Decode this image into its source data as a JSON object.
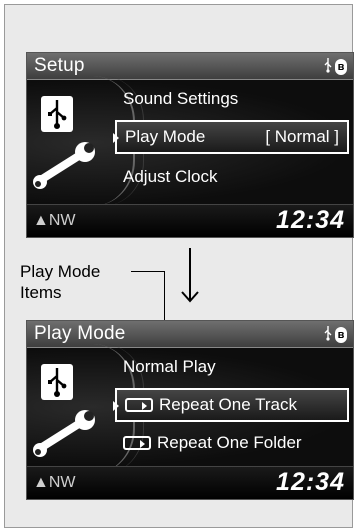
{
  "screens": [
    {
      "title": "Setup",
      "items": [
        {
          "label": "Sound Settings",
          "value": ""
        },
        {
          "label": "Play Mode",
          "value": "[ Normal ]"
        },
        {
          "label": "Adjust Clock",
          "value": ""
        }
      ],
      "compass": "NW",
      "clock": "12:34"
    },
    {
      "title": "Play Mode",
      "items": [
        {
          "label": "Normal Play"
        },
        {
          "label": "Repeat One Track"
        },
        {
          "label": "Repeat One Folder"
        }
      ],
      "compass": "NW",
      "clock": "12:34"
    }
  ],
  "callout": {
    "line1": "Play Mode",
    "line2": "Items"
  },
  "icons": [
    "usb-icon",
    "bluetooth-icon",
    "wrench-icon",
    "compass-arrow-icon",
    "repeat-icon",
    "down-arrow-icon"
  ]
}
